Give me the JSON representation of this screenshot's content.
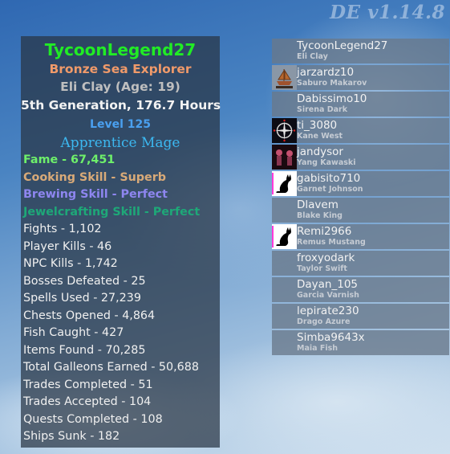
{
  "version": "DE v1.14.8",
  "profile": {
    "username": "TycoonLegend27",
    "title": "Bronze Sea Explorer",
    "character": "Eli Clay (Age: 19)",
    "generation": "5th Generation, 176.7 Hours",
    "level": "Level 125",
    "rank": "Apprentice Mage",
    "colors": {
      "username": "#21ec25",
      "title": "#f09a6a",
      "character": "#bfbfbf",
      "level": "#4aa0f0",
      "rank": "#3cb8f0"
    },
    "highlights": [
      {
        "text": "Fame - 67,451",
        "color": "#6ef06a"
      },
      {
        "text": "Cooking Skill - Superb",
        "color": "#d9aa78"
      },
      {
        "text": "Brewing Skill - Perfect",
        "color": "#8e86f0"
      },
      {
        "text": "Jewelcrafting Skill - Perfect",
        "color": "#1ea878"
      }
    ],
    "stats": [
      "Fights - 1,102",
      "Player Kills - 46",
      "NPC Kills - 1,742",
      "Bosses Defeated - 25",
      "Spells Used - 27,239",
      "Chests Opened - 4,864",
      "Fish Caught - 427",
      "Items Found - 70,285",
      "Total Galleons Earned - 50,688",
      "Trades Completed - 51",
      "Trades Accepted - 104",
      "Quests Completed - 108",
      "Ships Sunk - 182"
    ]
  },
  "players": [
    {
      "username": "TycoonLegend27",
      "name": "Eli Clay",
      "avatar": "none"
    },
    {
      "username": "jarzardz10",
      "name": "Saburo Makarov",
      "avatar": "pirate-ship-emblem"
    },
    {
      "username": "Dabissimo10",
      "name": "Sirena Dark",
      "avatar": "none"
    },
    {
      "username": "ti_3080",
      "name": "Kane West",
      "avatar": "compass-emblem"
    },
    {
      "username": "jandysor",
      "name": "Yang Kawaski",
      "avatar": "skeletons-emblem"
    },
    {
      "username": "gabisito710",
      "name": "Garnet Johnson",
      "avatar": "black-cat-emblem",
      "accent": "#ff39d8"
    },
    {
      "username": "Dlavem",
      "name": "Blake King",
      "avatar": "none"
    },
    {
      "username": "Remi2966",
      "name": "Remus Mustang",
      "avatar": "black-cat-emblem",
      "accent": "#ff39d8"
    },
    {
      "username": "froxyodark",
      "name": "Taylor Swift",
      "avatar": "none"
    },
    {
      "username": "Dayan_105",
      "name": "Garcia Varnish",
      "avatar": "none"
    },
    {
      "username": "lepirate230",
      "name": "Drago Azure",
      "avatar": "none"
    },
    {
      "username": "Simba9643x",
      "name": "Maia Fish",
      "avatar": "none"
    }
  ]
}
